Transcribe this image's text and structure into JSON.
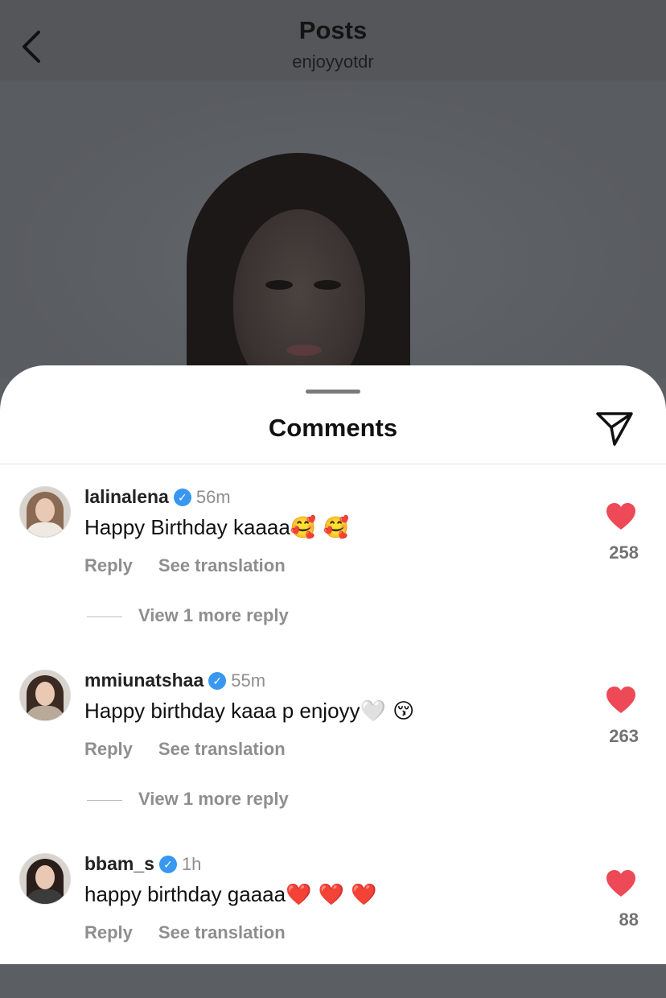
{
  "header": {
    "title": "Posts",
    "subtitle": "enjoyyotdr",
    "back_icon": "chevron-left-icon"
  },
  "sheet": {
    "title": "Comments",
    "share_icon": "paper-plane-icon"
  },
  "colors": {
    "verified": "#3897f0",
    "like": "#ed4956",
    "muted": "#8e8e8e"
  },
  "comments": [
    {
      "username": "lalinalena",
      "verified_mark": "✓",
      "time": "56m",
      "text": "Happy Birthday kaaaa",
      "emoji": "🥰 🥰",
      "reply": "Reply",
      "translate": "See translation",
      "likes": "258",
      "more_replies": "View 1 more reply"
    },
    {
      "username": "mmiunatshaa",
      "verified_mark": "✓",
      "time": "55m",
      "text": "Happy birthday kaaa p enjoyy",
      "emoji": "🤍 😚",
      "reply": "Reply",
      "translate": "See translation",
      "likes": "263",
      "more_replies": "View 1 more reply"
    },
    {
      "username": "bbam_s",
      "verified_mark": "✓",
      "time": "1h",
      "text": "happy birthday gaaaa",
      "emoji": "❤️ ❤️ ❤️",
      "reply": "Reply",
      "translate": "See translation",
      "likes": "88"
    }
  ]
}
